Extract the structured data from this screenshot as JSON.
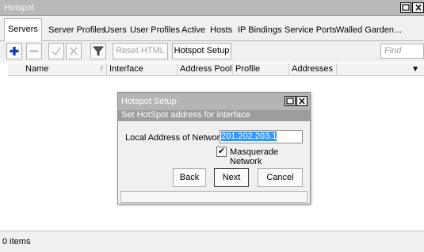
{
  "window": {
    "title": "Hotspot",
    "restore_icon": "restore-icon",
    "close_icon": "close-icon"
  },
  "tabs": [
    {
      "label": "Servers",
      "active": true
    },
    {
      "label": "Server Profiles"
    },
    {
      "label": "Users"
    },
    {
      "label": "User Profiles"
    },
    {
      "label": "Active"
    },
    {
      "label": "Hosts"
    },
    {
      "label": "IP Bindings"
    },
    {
      "label": "Service Ports"
    },
    {
      "label": "Walled Garden"
    },
    {
      "label": "..."
    }
  ],
  "toolbar": {
    "add_icon": "plus-icon",
    "remove_icon": "minus-icon",
    "enable_icon": "check-icon",
    "disable_icon": "cross-icon",
    "filter_icon": "filter-icon",
    "reset_html": "Reset HTML",
    "hotspot_setup": "Hotspot Setup",
    "find_placeholder": "Find",
    "accent": "#1a3fb4"
  },
  "table": {
    "columns": [
      "Name",
      "Interface",
      "Address Pool",
      "Profile",
      "Addresses ..."
    ]
  },
  "status_bar": {
    "text": "0 items"
  },
  "dialog": {
    "title": "Hotspot Setup",
    "subtitle": "Set HotSpot address for interface",
    "field_label": "Local Address of Network:",
    "field_value": "201.202.203.1",
    "checkbox_label": "Masquerade Network",
    "checkbox_checked": true,
    "buttons": {
      "back": "Back",
      "next": "Next",
      "cancel": "Cancel"
    }
  }
}
